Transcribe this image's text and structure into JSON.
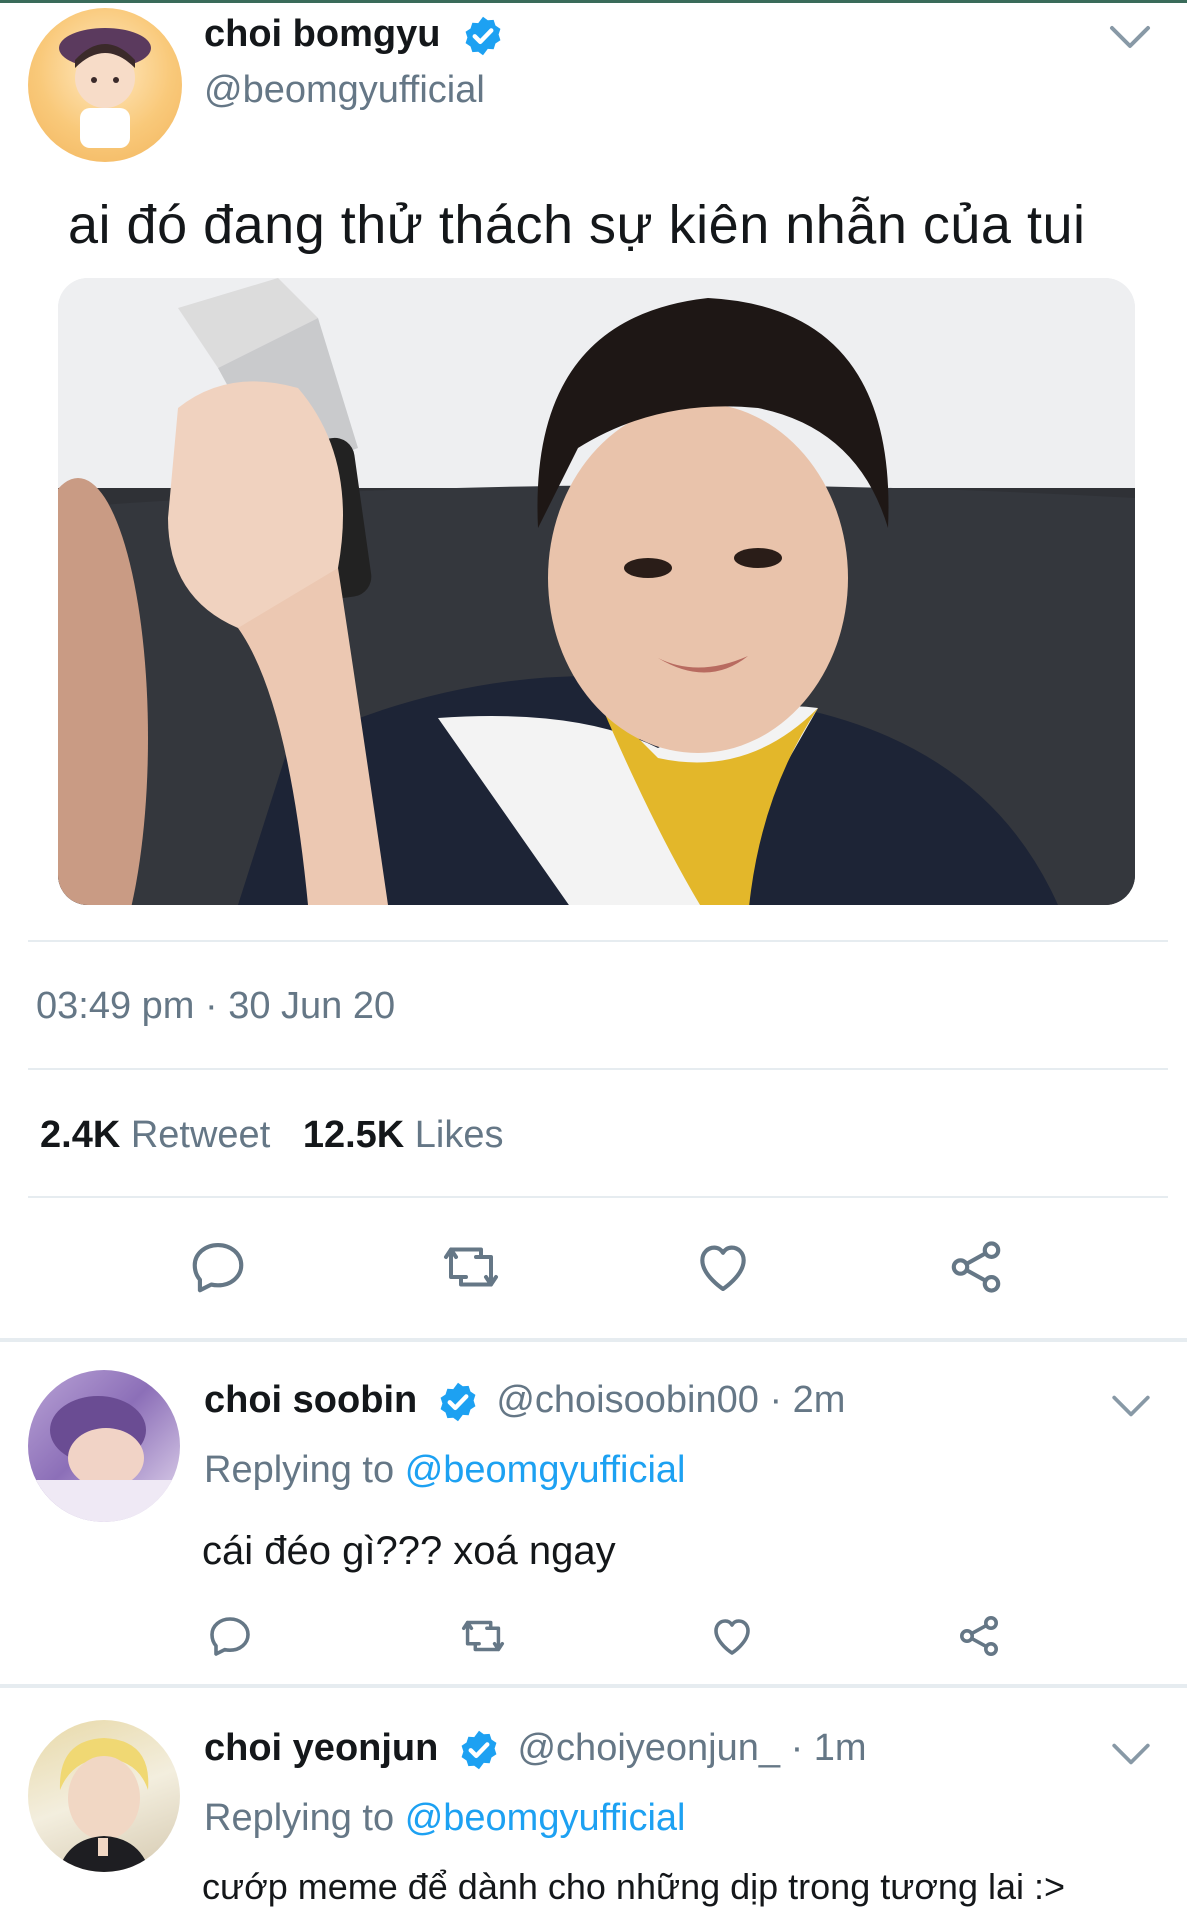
{
  "colors": {
    "accent": "#1da1f2",
    "text": "#14171a",
    "muted": "#657786",
    "divider": "#e6ecf0"
  },
  "main_tweet": {
    "display_name": "choi bomgyu",
    "handle": "@beomgyufficial",
    "verified": true,
    "text": "ai đó đang thử thách sự kiên nhẫn của tui",
    "timestamp": "03:49 pm · 30 Jun 20",
    "stats": {
      "retweets_count": "2.4K",
      "retweets_label": "Retweet",
      "likes_count": "12.5K",
      "likes_label": "Likes"
    },
    "actions": [
      "reply-icon",
      "retweet-icon",
      "like-icon",
      "share-icon"
    ]
  },
  "replies": [
    {
      "display_name": "choi soobin",
      "handle": "@choisoobin00",
      "time": "· 2m",
      "verified": true,
      "replying_prefix": "Replying to",
      "replying_to": "@beomgyufficial",
      "text": "cái đéo gì??? xoá ngay"
    },
    {
      "display_name": "choi yeonjun",
      "handle": "@choiyeonjun_",
      "time": "· 1m",
      "verified": true,
      "replying_prefix": "Replying to",
      "replying_to": "@beomgyufficial",
      "text": "cướp meme để dành cho những dịp trong tương lai :>"
    }
  ]
}
